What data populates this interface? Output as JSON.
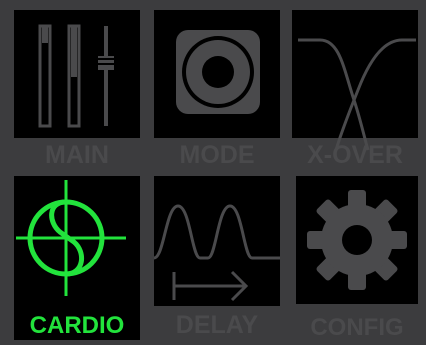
{
  "colors": {
    "background": "#3c3c3e",
    "panel": "#000000",
    "icon": "#4a4a4c",
    "label": "#4a4a4c",
    "active": "#22e33c"
  },
  "active_tile": "cardio",
  "tiles": {
    "main": {
      "label": "MAIN",
      "icon": "faders-icon"
    },
    "mode": {
      "label": "MODE",
      "icon": "speaker-icon"
    },
    "xover": {
      "label": "X-OVER",
      "icon": "crossover-curve-icon"
    },
    "cardio": {
      "label": "CARDIO",
      "icon": "cardioid-icon"
    },
    "delay": {
      "label": "DELAY",
      "icon": "delay-wave-arrow-icon"
    },
    "config": {
      "label": "CONFIG",
      "icon": "gear-icon"
    }
  }
}
